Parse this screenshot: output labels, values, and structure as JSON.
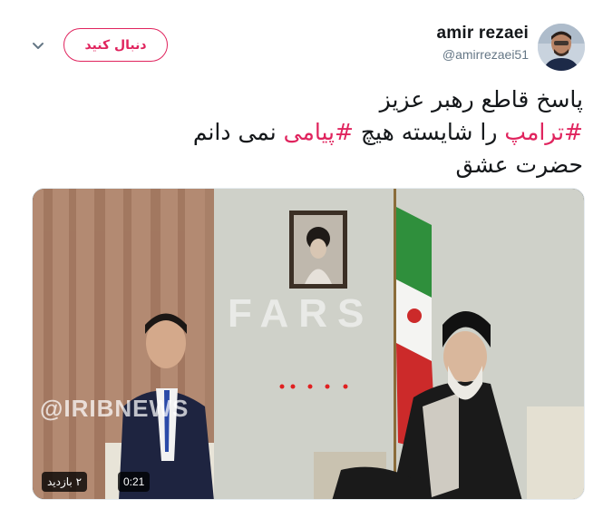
{
  "header": {
    "display_name": "amir rezaei",
    "handle": "@amirrezaei51",
    "follow_label": "دنبال کنید",
    "accent_color": "#e0245e"
  },
  "icons": {
    "caret": "chevron-down-icon",
    "avatar": "avatar-photo"
  },
  "tweet": {
    "line1": "پاسخ قاطع رهبر عزیز",
    "line2_hashtag1": "#ترامپ",
    "line2_mid": " را شایسته هیچ ",
    "line2_hashtag2": "#پیامی",
    "line2_end": " نمی دانم",
    "line3": "حضرت عشق"
  },
  "media": {
    "duration": "0:21",
    "views": "۲ بازدید",
    "watermark_fars": "FARS",
    "watermark_irib": "@IRIBNEWS"
  }
}
